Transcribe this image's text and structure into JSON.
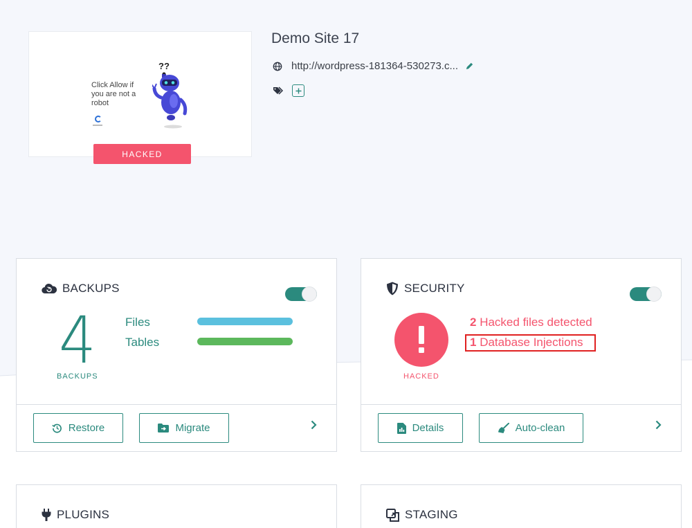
{
  "site": {
    "title": "Demo Site 17",
    "url": "http://wordpress-181364-530273.c...",
    "status_ribbon": "HACKED",
    "thumbnail_text": "Click Allow if you are not a robot",
    "thumbnail_robot_text": "??"
  },
  "icons": {
    "globe": "globe-icon",
    "edit": "pencil-icon",
    "tags": "tags-icon",
    "add_tag": "plus-icon"
  },
  "backups": {
    "title": "BACKUPS",
    "count": "4",
    "count_label": "BACKUPS",
    "rows": [
      {
        "label": "Files",
        "color": "#5bc0de"
      },
      {
        "label": "Tables",
        "color": "#5cb85c"
      }
    ],
    "toggle_on": true,
    "buttons": {
      "restore": "Restore",
      "migrate": "Migrate"
    }
  },
  "security": {
    "title": "SECURITY",
    "status_label": "HACKED",
    "hacked_files_count": "2",
    "hacked_files_text": "Hacked files detected",
    "injections_count": "1",
    "injections_text": "Database Injections",
    "toggle_on": true,
    "buttons": {
      "details": "Details",
      "autoclean": "Auto-clean"
    }
  },
  "plugins": {
    "title": "PLUGINS"
  },
  "staging": {
    "title": "STAGING"
  },
  "colors": {
    "accent": "#2b8a7e",
    "danger": "#f4546d",
    "highlight_box": "#e02020",
    "background": "#f5f7fc"
  }
}
